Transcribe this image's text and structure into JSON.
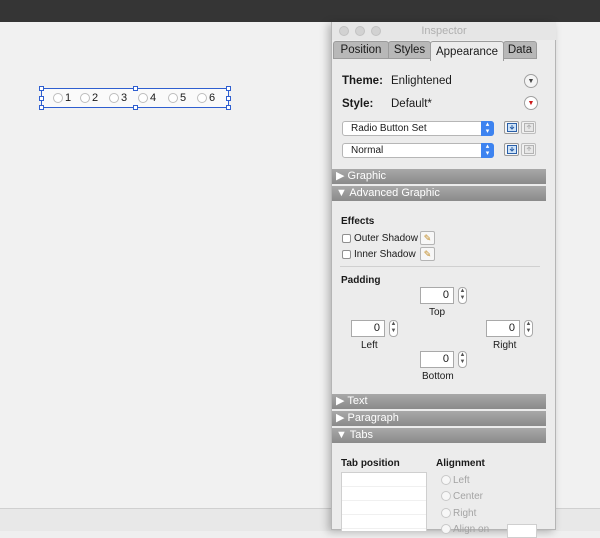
{
  "canvas": {
    "radio_labels": [
      "1",
      "2",
      "3",
      "4",
      "5",
      "6"
    ]
  },
  "inspector": {
    "title": "Inspector",
    "tabs": [
      {
        "label": "Position",
        "active": false
      },
      {
        "label": "Styles",
        "active": false
      },
      {
        "label": "Appearance",
        "active": true
      },
      {
        "label": "Data",
        "active": false
      }
    ],
    "theme_label": "Theme:",
    "theme_value": "Enlightened",
    "style_label": "Style:",
    "style_value": "Default*",
    "popups": [
      "Radio Button Set",
      "Normal"
    ],
    "sections": {
      "graphic": "Graphic",
      "advanced_graphic": "Advanced Graphic",
      "text": "Text",
      "paragraph": "Paragraph",
      "tabs": "Tabs"
    },
    "effects": {
      "title": "Effects",
      "outer_shadow": "Outer Shadow",
      "inner_shadow": "Inner Shadow"
    },
    "padding": {
      "title": "Padding",
      "top": {
        "label": "Top",
        "value": "0"
      },
      "left": {
        "label": "Left",
        "value": "0"
      },
      "right": {
        "label": "Right",
        "value": "0"
      },
      "bottom": {
        "label": "Bottom",
        "value": "0"
      }
    },
    "tabs_section": {
      "tab_position": "Tab position",
      "alignment": "Alignment",
      "alignment_options": [
        "Left",
        "Center",
        "Right",
        "Align on"
      ]
    }
  },
  "colors": {
    "selection_blue": "#2f5fd0",
    "popup_accent": "#3d83f0",
    "section_gray": "#999999"
  }
}
